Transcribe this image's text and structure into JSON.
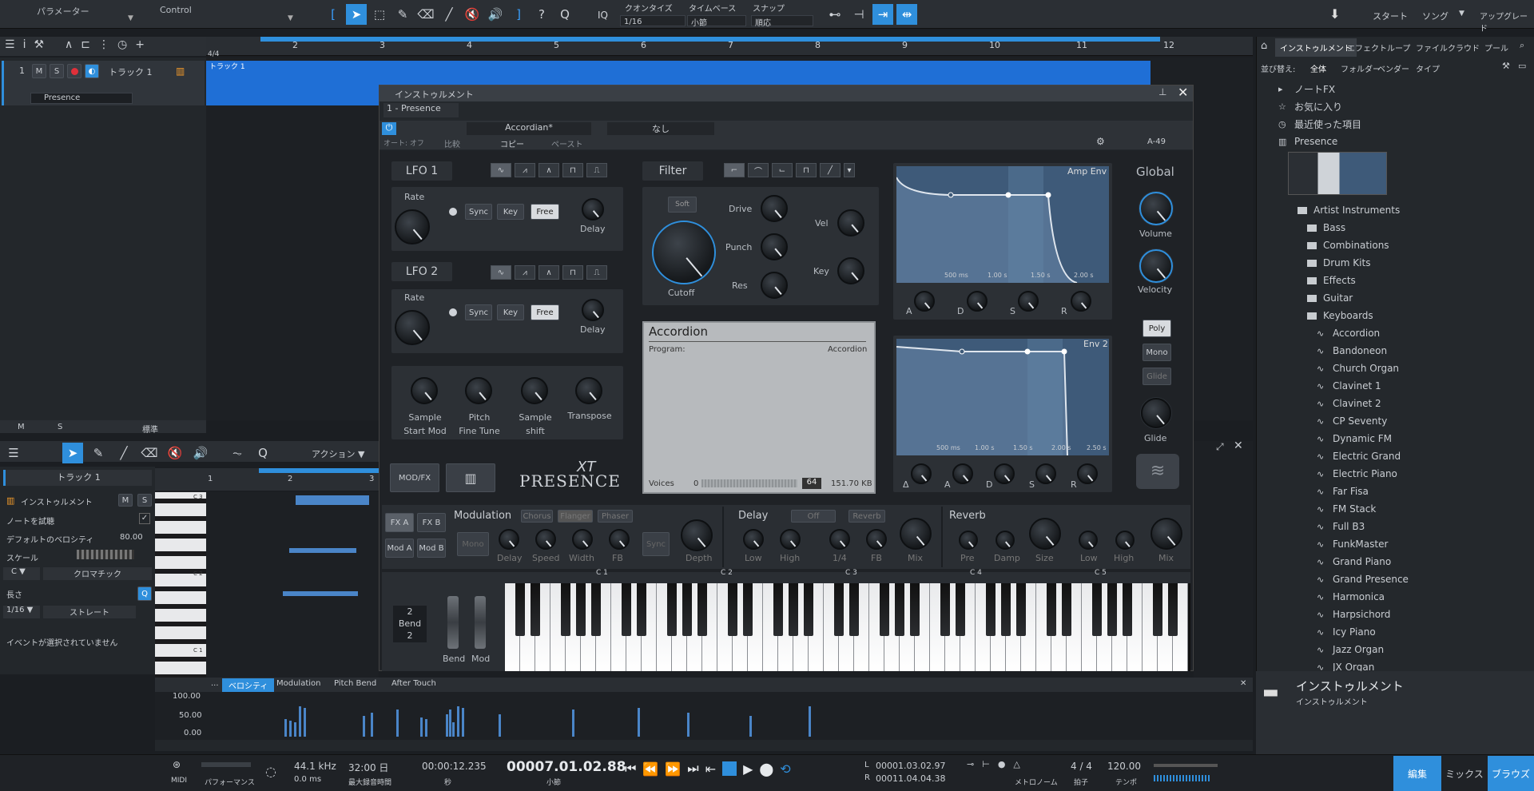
{
  "toolbar": {
    "param_label": "パラメーター",
    "control_label": "Control",
    "quantize_label": "クオンタイズ",
    "quantize_value": "1/16",
    "timebase_label": "タイムベース",
    "timebase_value": "小節",
    "snap_label": "スナップ",
    "snap_value": "順応",
    "iq": "IQ",
    "help": "?",
    "nav_start": "スタート",
    "nav_song": "ソング",
    "nav_upgrade": "アップグレード"
  },
  "arrange": {
    "ruler_marks": [
      "2",
      "3",
      "4",
      "5",
      "6",
      "7",
      "8",
      "9",
      "10",
      "11",
      "12"
    ],
    "time_sig": "4/4",
    "track_number": "1",
    "track_name": "トラック 1",
    "track_m": "M",
    "track_s": "S",
    "instrument": "Presence",
    "clip_label": "トラック 1",
    "footer_m": "M",
    "footer_s": "S",
    "footer_std": "標準"
  },
  "plugin": {
    "window_title": "インストゥルメント",
    "instance": "1 - Presence",
    "preset": "Accordian*",
    "sidechain": "なし",
    "auto_off": "オート: オフ",
    "compare": "比較",
    "copy": "コピー",
    "paste": "ペースト",
    "device": "A-49",
    "lfo1": "LFO 1",
    "lfo2": "LFO 2",
    "rate": "Rate",
    "sync": "Sync",
    "key": "Key",
    "free": "Free",
    "delay": "Delay",
    "filter": "Filter",
    "soft": "Soft",
    "drive": "Drive",
    "punch": "Punch",
    "res": "Res",
    "cutoff": "Cutoff",
    "vel": "Vel",
    "filter_key": "Key",
    "amp_env": "Amp Env",
    "env2": "Env 2",
    "env_ticks": [
      "500 ms",
      "1.00 s",
      "1.50 s",
      "2.00 s"
    ],
    "env2_ticks": [
      "500 ms",
      "1.00 s",
      "1.50 s",
      "2.00 s",
      "2.50 s"
    ],
    "a": "A",
    "d": "D",
    "s": "S",
    "r": "R",
    "delta": "Δ",
    "global": "Global",
    "volume": "Volume",
    "velocity": "Velocity",
    "poly": "Poly",
    "mono": "Mono",
    "glide_btn": "Glide",
    "glide": "Glide",
    "sample_start": "Sample\nStart Mod",
    "pitch_fine": "Pitch\nFine Tune",
    "sample_shift": "Sample\nshift",
    "transpose": "Transpose",
    "display_title": "Accordion",
    "program_label": "Program:",
    "program_value": "Accordion",
    "voices_label": "Voices",
    "voices_min": "0",
    "voices_value": "64",
    "mem": "151.70 KB",
    "modfx": "MOD/FX",
    "logo_xt": "XT",
    "logo": "PRESENCE",
    "fxa": "FX A",
    "fxb": "FX B",
    "moda": "Mod A",
    "modb": "Mod B",
    "modulation": "Modulation",
    "chorus": "Chorus",
    "flanger": "Flanger",
    "phaser": "Phaser",
    "mono_fx": "Mono",
    "mod_delay": "Delay",
    "speed": "Speed",
    "width": "Width",
    "fb": "FB",
    "mod_sync": "Sync",
    "depth": "Depth",
    "delay_title": "Delay",
    "delay_off": "Off",
    "delay_reverb": "Reverb",
    "low": "Low",
    "high": "High",
    "quarter": "1/4",
    "dfb": "FB",
    "mix": "Mix",
    "reverb_title": "Reverb",
    "pre": "Pre",
    "damp": "Damp",
    "size": "Size",
    "rlow": "Low",
    "rhigh": "High",
    "rmix": "Mix",
    "octaves": [
      "C 1",
      "C 2",
      "C 3",
      "C 4",
      "C 5"
    ],
    "bend_range": "2",
    "bend_label": "Bend",
    "bend_range2": "2",
    "bend": "Bend",
    "mod": "Mod"
  },
  "editor": {
    "action": "アクション",
    "track": "トラック 1",
    "instrument": "インストゥルメント",
    "m": "M",
    "s": "S",
    "audition": "ノートを試聴",
    "default_vel": "デフォルトのベロシティ",
    "default_vel_value": "80.00",
    "scale": "スケール",
    "scale_root": "C",
    "scale_type": "クロマチック",
    "length": "長さ",
    "len_value": "1/16",
    "len_mode": "ストレート",
    "no_event": "イベントが選択されていません",
    "ruler": [
      "1",
      "2",
      "3"
    ],
    "keys": [
      "C 3",
      "C 2",
      "C 1"
    ],
    "lanes": [
      "...",
      "ベロシティ",
      "Modulation",
      "Pitch Bend",
      "After Touch"
    ],
    "vel_axis": [
      "100.00",
      "50.00",
      "0.00"
    ]
  },
  "browser": {
    "tabs": [
      "インストゥルメント",
      "エフェクト",
      "ループ",
      "ファイル",
      "クラウド",
      "プール"
    ],
    "sort_label": "並び替え:",
    "sort_options": [
      "全体",
      "フォルダー",
      "ベンダー",
      "タイプ"
    ],
    "items": [
      {
        "label": "ノートFX"
      },
      {
        "label": "お気に入り"
      },
      {
        "label": "最近使った項目"
      },
      {
        "label": "Presence"
      },
      {
        "label": "Artist Instruments"
      },
      {
        "label": "Bass"
      },
      {
        "label": "Combinations"
      },
      {
        "label": "Drum Kits"
      },
      {
        "label": "Effects"
      },
      {
        "label": "Guitar"
      },
      {
        "label": "Keyboards"
      },
      {
        "label": "Accordion"
      },
      {
        "label": "Bandoneon"
      },
      {
        "label": "Church Organ"
      },
      {
        "label": "Clavinet 1"
      },
      {
        "label": "Clavinet 2"
      },
      {
        "label": "CP Seventy"
      },
      {
        "label": "Dynamic FM"
      },
      {
        "label": "Electric Grand"
      },
      {
        "label": "Electric Piano"
      },
      {
        "label": "Far Fisa"
      },
      {
        "label": "FM Stack"
      },
      {
        "label": "Full B3"
      },
      {
        "label": "FunkMaster"
      },
      {
        "label": "Grand Piano"
      },
      {
        "label": "Grand Presence"
      },
      {
        "label": "Harmonica"
      },
      {
        "label": "Harpsichord"
      },
      {
        "label": "Icy Piano"
      },
      {
        "label": "Jazz Organ"
      },
      {
        "label": "JX Organ"
      }
    ],
    "footer_title": "インストゥルメント",
    "footer_sub": "インストゥルメント"
  },
  "transport": {
    "midi": "MIDI",
    "performance": "パフォーマンス",
    "sample_rate": "44.1 kHz",
    "latency": "0.0 ms",
    "record_time": "32:00 日",
    "record_label": "最大録音時間",
    "seconds": "00:00:12.235",
    "seconds_label": "秒",
    "bars": "00007.01.02.88",
    "bars_label": "小節",
    "loop_l": "00001.03.02.97",
    "loop_r": "00011.04.04.38",
    "l": "L",
    "r": "R",
    "metronome": "メトロノーム",
    "sig": "4 / 4",
    "sig_label": "拍子",
    "tempo": "120.00",
    "tempo_label": "テンポ",
    "edit": "編集",
    "mix": "ミックス",
    "browse": "ブラウズ"
  },
  "colors": {
    "accent": "#2f8fdc",
    "track_blue": "#1f6fd6",
    "record": "#e0303a"
  }
}
